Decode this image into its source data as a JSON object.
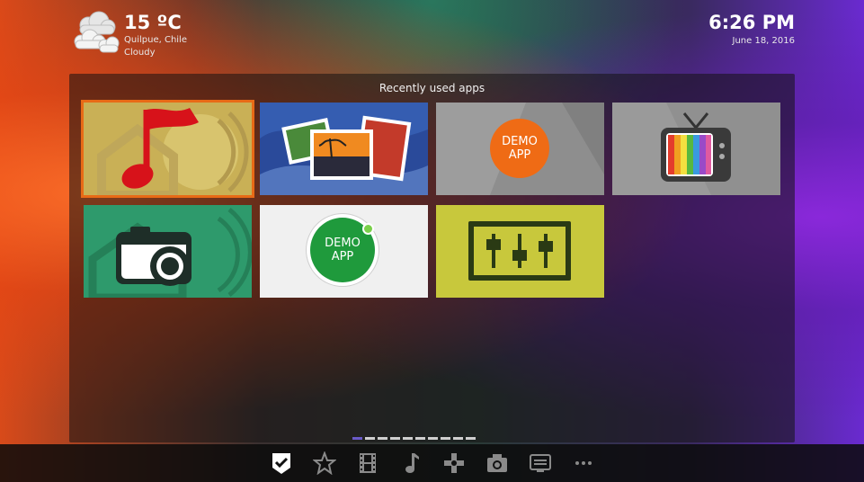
{
  "weather": {
    "temperature": "15 ºC",
    "location": "Quilpue, Chile",
    "condition": "Cloudy",
    "icon": "cloudy-icon"
  },
  "clock": {
    "time": "6:26 PM",
    "date": "June 18, 2016"
  },
  "panel": {
    "title": "Recently used apps",
    "apps": [
      {
        "icon": "music-note-icon",
        "selected": true
      },
      {
        "icon": "photo-gallery-icon",
        "selected": false
      },
      {
        "icon": "demo-app-icon",
        "label": "DEMO\nAPP",
        "selected": false
      },
      {
        "icon": "tv-icon",
        "selected": false
      },
      {
        "icon": "camera-icon",
        "selected": false
      },
      {
        "icon": "demo-app-icon",
        "label": "DEMO\nAPP",
        "selected": false
      },
      {
        "icon": "equalizer-icon",
        "selected": false
      }
    ]
  },
  "pager": {
    "pages": 10,
    "current": 1
  },
  "bottom_nav": [
    {
      "icon": "recent-apps-icon",
      "active": true
    },
    {
      "icon": "star-icon",
      "active": false
    },
    {
      "icon": "film-icon",
      "active": false
    },
    {
      "icon": "music-icon",
      "active": false
    },
    {
      "icon": "games-icon",
      "active": false
    },
    {
      "icon": "camera-icon",
      "active": false
    },
    {
      "icon": "tv-icon",
      "active": false
    },
    {
      "icon": "more-icon",
      "active": false
    }
  ],
  "colors": {
    "selection": "#e86a16",
    "pager_active": "#6a5ac8"
  }
}
